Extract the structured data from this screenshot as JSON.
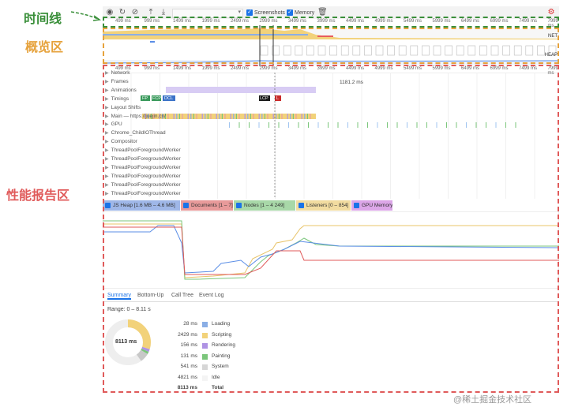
{
  "annotations": {
    "timeline": "时间线",
    "overview": "概览区",
    "report": "性能报告区",
    "timeline_color": "#3a8f3a",
    "overview_color": "#e6a23c",
    "report_color": "#e05a5a"
  },
  "toolbar": {
    "url_placeholder": "...",
    "screenshots_label": "Screenshots",
    "memory_label": "Memory"
  },
  "overview": {
    "ruler": [
      "499 ms",
      "999 ms",
      "1499 ms",
      "1999 ms",
      "2499 ms",
      "2999 ms",
      "3499 ms",
      "3999 ms",
      "4499 ms",
      "4999 ms",
      "5499 ms",
      "5999 ms",
      "6499 ms",
      "6999 ms",
      "7499 ms",
      "7999 ms"
    ],
    "net_label": "NET",
    "heap_label": "HEAP"
  },
  "main": {
    "ruler": [
      "499 ms",
      "999 ms",
      "1499 ms",
      "1999 ms",
      "2499 ms",
      "2999 ms",
      "3499 ms",
      "3999 ms",
      "4499 ms",
      "4999 ms",
      "5499 ms",
      "5999 ms",
      "6499 ms",
      "6999 ms",
      "7499 ms",
      "7999 ms"
    ],
    "frame_time": "1181.2 ms",
    "tracks": [
      "Network",
      "Frames",
      "Animations",
      "Timings",
      "Layout Shifts",
      "Main — https://juejin.cn/",
      "GPU",
      "Chrome_ChildIOThread",
      "Compositor",
      "ThreadPoolForegroundWorker",
      "ThreadPoolForegroundWorker",
      "ThreadPoolForegroundWorker",
      "ThreadPoolForegroundWorker",
      "ThreadPoolForegroundWorker",
      "ThreadPoolForegroundWorker"
    ],
    "timings": [
      "FP",
      "FCP",
      "DCL",
      "LCP",
      "L"
    ]
  },
  "memory_legend": [
    {
      "label": "JS Heap [1.6 MB – 4.6 MB]",
      "color": "#9fb7e8"
    },
    {
      "label": "Documents [1 – 7]",
      "color": "#e89a9a"
    },
    {
      "label": "Nodes [1 – 4 249]",
      "color": "#a8d8a8"
    },
    {
      "label": "Listeners [0 – 854]",
      "color": "#f2dca0"
    },
    {
      "label": "GPU Memory",
      "color": "#dca6e8"
    }
  ],
  "tabs": [
    "Summary",
    "Bottom-Up",
    "Call Tree",
    "Event Log"
  ],
  "summary": {
    "range": "Range: 0 – 8.11 s",
    "donut_label": "8113 ms",
    "rows": [
      {
        "value": "28 ms",
        "label": "Loading",
        "color": "#8aaee5"
      },
      {
        "value": "2429 ms",
        "label": "Scripting",
        "color": "#f2d27a"
      },
      {
        "value": "156 ms",
        "label": "Rendering",
        "color": "#af93e4"
      },
      {
        "value": "131 ms",
        "label": "Painting",
        "color": "#7bc67b"
      },
      {
        "value": "541 ms",
        "label": "System",
        "color": "#d6d6d6"
      },
      {
        "value": "4821 ms",
        "label": "Idle",
        "color": "#f4f4f4"
      },
      {
        "value": "8113 ms",
        "label": "Total",
        "color": ""
      }
    ]
  },
  "watermark": "@稀土掘金技术社区"
}
